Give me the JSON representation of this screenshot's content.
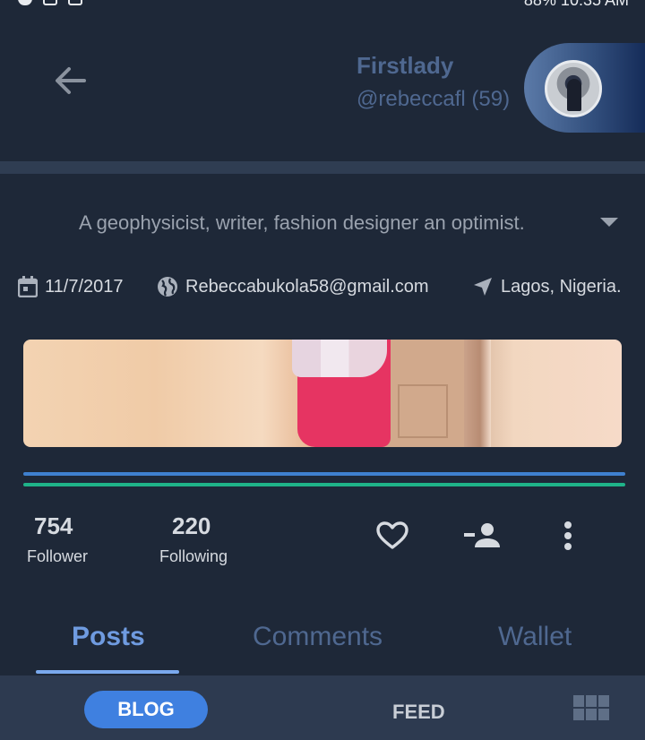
{
  "status_bar": {
    "right_text": "88% 10:35 AM"
  },
  "header": {
    "name": "Firstlady",
    "handle": "@rebeccafl (59)"
  },
  "profile": {
    "bio": "A geophysicist, writer, fashion designer an optimist.",
    "meta": {
      "date": "11/7/2017",
      "email": "Rebeccabukola58@gmail.com",
      "location": "Lagos, Nigeria."
    }
  },
  "stats": {
    "followers": {
      "value": "754",
      "label": "Follower"
    },
    "following": {
      "value": "220",
      "label": "Following"
    }
  },
  "tabs": [
    {
      "label": "Posts",
      "active": true
    },
    {
      "label": "Comments",
      "active": false
    },
    {
      "label": "Wallet",
      "active": false
    }
  ],
  "bottom_nav": {
    "blog": "BLOG",
    "feed": "FEED"
  },
  "colors": {
    "background": "#1e2838",
    "accent_blue": "#3f80e0",
    "accent_green": "#1fb389",
    "muted_blue": "#4f6890"
  },
  "icons": [
    "back-arrow-icon",
    "chevron-down-icon",
    "calendar-icon",
    "globe-icon",
    "location-arrow-icon",
    "heart-icon",
    "follow-user-icon",
    "more-vertical-icon",
    "grid-icon"
  ]
}
